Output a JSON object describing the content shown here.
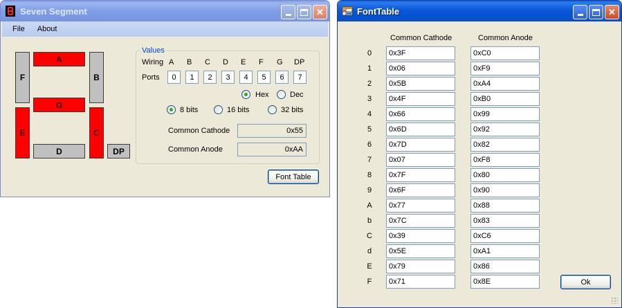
{
  "seven_segment": {
    "title": "Seven Segment",
    "icon": "seven-segment-digit-icon",
    "menu": [
      "File",
      "About"
    ],
    "segments": {
      "A": {
        "label": "A",
        "on": true
      },
      "B": {
        "label": "B",
        "on": false
      },
      "C": {
        "label": "C",
        "on": true
      },
      "D": {
        "label": "D",
        "on": false
      },
      "E": {
        "label": "E",
        "on": true
      },
      "F": {
        "label": "F",
        "on": false
      },
      "G": {
        "label": "G",
        "on": true
      },
      "DP": {
        "label": "DP",
        "on": false
      }
    },
    "colors": {
      "segment_on": "#ff0000",
      "segment_off": "#c0c0c0",
      "group_title": "#0046d5"
    },
    "values_group": {
      "title": "Values",
      "wiring_label": "Wiring",
      "wiring": [
        "A",
        "B",
        "C",
        "D",
        "E",
        "F",
        "G",
        "DP"
      ],
      "ports_label": "Ports",
      "ports": [
        "0",
        "1",
        "2",
        "3",
        "4",
        "5",
        "6",
        "7"
      ],
      "format": {
        "hex": "Hex",
        "dec": "Dec",
        "selected": "Hex"
      },
      "bits": {
        "b8": "8 bits",
        "b16": "16 bits",
        "b32": "32 bits",
        "selected": "8 bits"
      },
      "common_cathode_label": "Common Cathode",
      "common_cathode_value": "0x55",
      "common_anode_label": "Common Anode",
      "common_anode_value": "0xAA"
    },
    "font_table_button": "Font Table"
  },
  "font_table": {
    "title": "FontTable",
    "icon": "table-icon",
    "col_cathode": "Common Cathode",
    "col_anode": "Common Anode",
    "rows": [
      {
        "label": "0",
        "cathode": "0x3F",
        "anode": "0xC0"
      },
      {
        "label": "1",
        "cathode": "0x06",
        "anode": "0xF9"
      },
      {
        "label": "2",
        "cathode": "0x5B",
        "anode": "0xA4"
      },
      {
        "label": "3",
        "cathode": "0x4F",
        "anode": "0xB0"
      },
      {
        "label": "4",
        "cathode": "0x66",
        "anode": "0x99"
      },
      {
        "label": "5",
        "cathode": "0x6D",
        "anode": "0x92"
      },
      {
        "label": "6",
        "cathode": "0x7D",
        "anode": "0x82"
      },
      {
        "label": "7",
        "cathode": "0x07",
        "anode": "0xF8"
      },
      {
        "label": "8",
        "cathode": "0x7F",
        "anode": "0x80"
      },
      {
        "label": "9",
        "cathode": "0x6F",
        "anode": "0x90"
      },
      {
        "label": "A",
        "cathode": "0x77",
        "anode": "0x88"
      },
      {
        "label": "b",
        "cathode": "0x7C",
        "anode": "0x83"
      },
      {
        "label": "C",
        "cathode": "0x39",
        "anode": "0xC6"
      },
      {
        "label": "d",
        "cathode": "0x5E",
        "anode": "0xA1"
      },
      {
        "label": "E",
        "cathode": "0x79",
        "anode": "0x86"
      },
      {
        "label": "F",
        "cathode": "0x71",
        "anode": "0x8E"
      }
    ],
    "ok_button": "Ok"
  }
}
